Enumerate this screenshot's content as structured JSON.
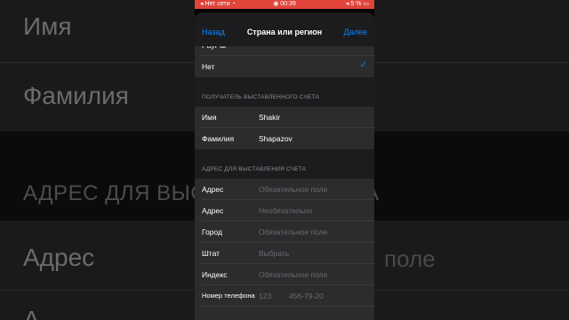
{
  "background": {
    "name_label": "Имя",
    "surname_label": "Фамилия",
    "address_section": "АДРЕС ДЛЯ ВЫСТ",
    "address_section_tail": "А",
    "address_label": "Адрес",
    "placeholder_tail": "поле",
    "bottom_partial": "А"
  },
  "status_bar": {
    "carrier": "Нет сети",
    "time": "00:39",
    "battery": "5 %"
  },
  "nav": {
    "back": "Назад",
    "title": "Страна или регион",
    "done": "Далее"
  },
  "payment": {
    "partial_option": "PayPal",
    "selected_option": "Нет"
  },
  "recipient": {
    "header": "ПОЛУЧАТЕЛЬ ВЫСТАВЛЕННОГО СЧЕТА",
    "first_name_label": "Имя",
    "first_name_value": "Shakir",
    "last_name_label": "Фамилия",
    "last_name_value": "Shapazov"
  },
  "billing_address": {
    "header": "АДРЕС ДЛЯ ВЫСТАВЛЕНИЯ СЧЕТА",
    "rows": [
      {
        "label": "Адрес",
        "placeholder": "Обязательное поле"
      },
      {
        "label": "Адрес",
        "placeholder": "Необязательно"
      },
      {
        "label": "Город",
        "placeholder": "Обязательное поле"
      },
      {
        "label": "Штат",
        "placeholder": "Выбрать"
      },
      {
        "label": "Индекс",
        "placeholder": "Обязательное поле"
      }
    ],
    "phone_label": "Номер телефона",
    "phone_code_placeholder": "123",
    "phone_number_placeholder": "456-79-20"
  }
}
